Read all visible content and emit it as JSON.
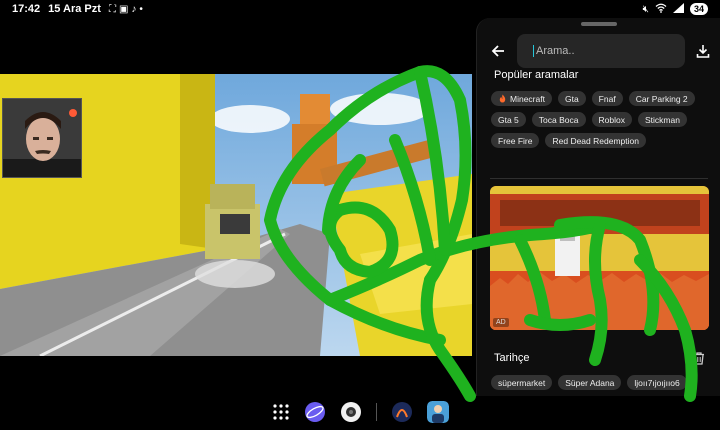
{
  "status_bar": {
    "time": "17:42",
    "date": "15 Ara Pzt",
    "battery": "34"
  },
  "search": {
    "placeholder": "Arama.."
  },
  "popular": {
    "title": "Popüler aramalar",
    "items": [
      "Minecraft",
      "Gta",
      "Fnaf",
      "Car Parking 2",
      "Gta 5",
      "Toca Boca",
      "Roblox",
      "Stickman",
      "Free Fire",
      "Red Dead Redemption"
    ]
  },
  "ad": {
    "badge": "AD"
  },
  "history": {
    "title": "Tarihçe",
    "items": [
      "süpermarket",
      "Süper Adana",
      "ljoıı7ıjoıjııo6"
    ]
  },
  "icons": {
    "back": "arrow-left-icon",
    "search": "search-icon",
    "mic": "mic-icon",
    "download": "download-icon",
    "trash": "trash-icon",
    "fire": "fire-icon"
  },
  "colors": {
    "panel_bg": "#0e0e0e",
    "chip_bg": "#333333",
    "scribble": "#1fb21f",
    "caret": "#26c6da"
  }
}
